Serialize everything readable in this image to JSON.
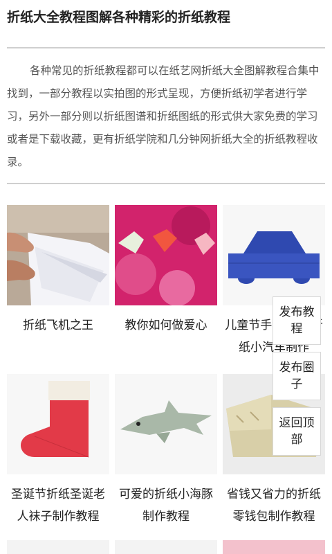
{
  "header": {
    "title": "折纸大全教程图解各种精彩的折纸教程"
  },
  "intro": {
    "text": "各种常见的折纸教程都可以在纸艺网折纸大全图解教程合集中找到，一部分教程以实拍图的形式呈现，方便折纸初学者进行学习，另外一部分则以折纸图谱和折纸图纸的形式供大家免费的学习或者是下载收藏，更有折纸学院和几分钟网折纸大全的折纸教程收录。"
  },
  "cards": [
    {
      "caption": "折纸飞机之王",
      "image": "paper-airplane-photo"
    },
    {
      "caption": "教你如何做爱心",
      "image": "paper-hearts-photo"
    },
    {
      "caption": "儿童节手工折纸 折纸小汽车制作",
      "image": "paper-car-diagram"
    },
    {
      "caption": "圣诞节折纸圣诞老人袜子制作教程",
      "image": "christmas-stocking-diagram"
    },
    {
      "caption": "可爱的折纸小海豚制作教程",
      "image": "paper-dolphin-diagram"
    },
    {
      "caption": "省钱又省力的折纸零钱包制作教程",
      "image": "paper-wallet-photo"
    }
  ],
  "floating_buttons": {
    "publish_tutorial": "发布教程",
    "publish_circle": "发布圈子",
    "back_to_top": "返回顶部"
  },
  "colors": {
    "title": "#222222",
    "body_text": "#555555",
    "divider": "#cfcfcf",
    "car_blue": "#2f49b0",
    "stocking_red": "#e23a48",
    "dolphin_gray": "#a9b8a8"
  }
}
